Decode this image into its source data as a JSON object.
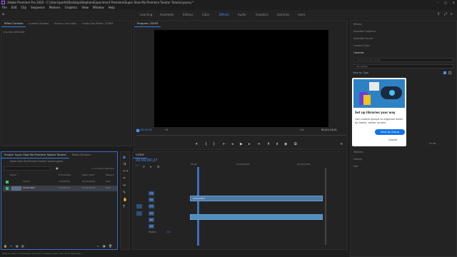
{
  "window": {
    "title": "Adobe Premiere Pro 2020 - C:\\Users\\parth\\Desktop\\Stephen\\Experiment Premiere\\Super Slow Mo Premiere Twixtor Tutorial.prproj *"
  },
  "menu": [
    "File",
    "Edit",
    "Clip",
    "Sequence",
    "Markers",
    "Graphics",
    "View",
    "Window",
    "Help"
  ],
  "workspaces": [
    "Learning",
    "Assembly",
    "Editing",
    "Color",
    "Effects",
    "Audio",
    "Graphics",
    "Libraries",
    "more"
  ],
  "active_workspace": "Effects",
  "effect_controls": {
    "tabs": [
      "Effect Controls",
      "Lumetri Scopes",
      "Source: (no clips)",
      "Audio Clip Mixer: C0393"
    ],
    "empty_text": "(no clip selected)"
  },
  "program": {
    "tab": "Program: C0393",
    "timecode_left": "00;00;00;00",
    "fit": "Fit",
    "full": "Full",
    "timecode_right": "00;01;13;01"
  },
  "right_panel": {
    "items": [
      "Effects",
      "Essential Graphics",
      "Essential Sound",
      "Lumetri Color",
      "Libraries"
    ],
    "search_placeholder": "Search Current Library",
    "library_select": "My Library",
    "view_by": "View by Type",
    "bottom_items": [
      "Markers",
      "History",
      "Info"
    ],
    "card": {
      "title": "Set up libraries your way",
      "body": "Use custom groups to organize items for faster, easier access.",
      "primary": "View by Group",
      "secondary": "Cancel"
    },
    "zoom_value": "50 MB"
  },
  "project": {
    "tabs": [
      "Project: Super Slow Mo Premiere Twixtor Tutorial",
      "Media Browser"
    ],
    "name": "Super Slow Mo Premiere Twixtor Tutorial.prproj",
    "count": "1 of 2 items selected",
    "columns": [
      "Name",
      "Frame Rate",
      "Media Start",
      "Media E"
    ],
    "rows": [
      {
        "name": "C0393",
        "rate": "119.88 fps",
        "start": "00;00;00;00",
        "end": "00;0"
      },
      {
        "name": "C0393.MP4",
        "rate": "119.88 fps",
        "start": "00;00;00;00",
        "end": "00;0"
      }
    ]
  },
  "timeline": {
    "tab": "C0393",
    "timecode": "00;00;00;27",
    "ruler": [
      ":00;00",
      "00;00;00;29",
      "00;00;00;29"
    ],
    "tracks": [
      "V3",
      "V2",
      "V1",
      "A1",
      "A2",
      "A3",
      "Master"
    ],
    "master_value": "0.0",
    "clip_label": "C0393.MP4"
  },
  "statusbar": "Drag to Insert in Overview. Use Ctrl to disable Insert. Use Alt to duplicate..."
}
